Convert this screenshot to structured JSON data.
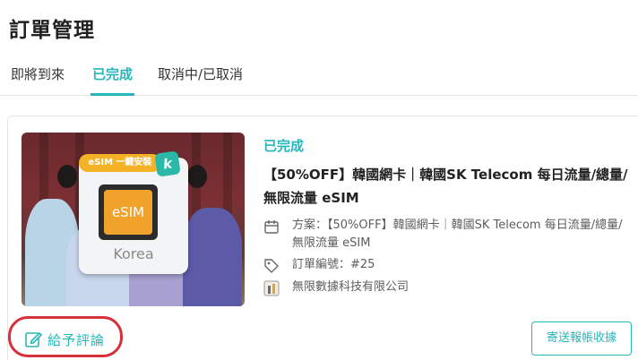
{
  "page": {
    "title": "訂單管理"
  },
  "tabs": [
    {
      "label": "即將到來",
      "active": false
    },
    {
      "label": "已完成",
      "active": true
    },
    {
      "label": "取消中/已取消",
      "active": false
    }
  ],
  "order": {
    "status": "已完成",
    "title": "【50%OFF】韓國網卡｜韓國SK Telecom 每日流量/總量/無限流量 eSIM",
    "image": {
      "banner": "eSIM 一鍵安裝",
      "badge": "k",
      "chip_label": "eSIM",
      "country": "Korea"
    },
    "plan_text": "方案：【50%OFF】韓國網卡｜韓國SK Telecom 每日流量/總量/無限流量 eSIM",
    "order_number_text": "訂單編號：#25",
    "vendor": "無限數據科技有限公司",
    "review_label": "給予評論",
    "receipt_label": "寄送報帳收據"
  },
  "colors": {
    "accent": "#26b7bc",
    "highlight": "#d5303b"
  },
  "icons": {
    "plan": "calendar-icon",
    "order": "tag-icon",
    "vendor": "store-icon",
    "review": "edit-icon"
  }
}
